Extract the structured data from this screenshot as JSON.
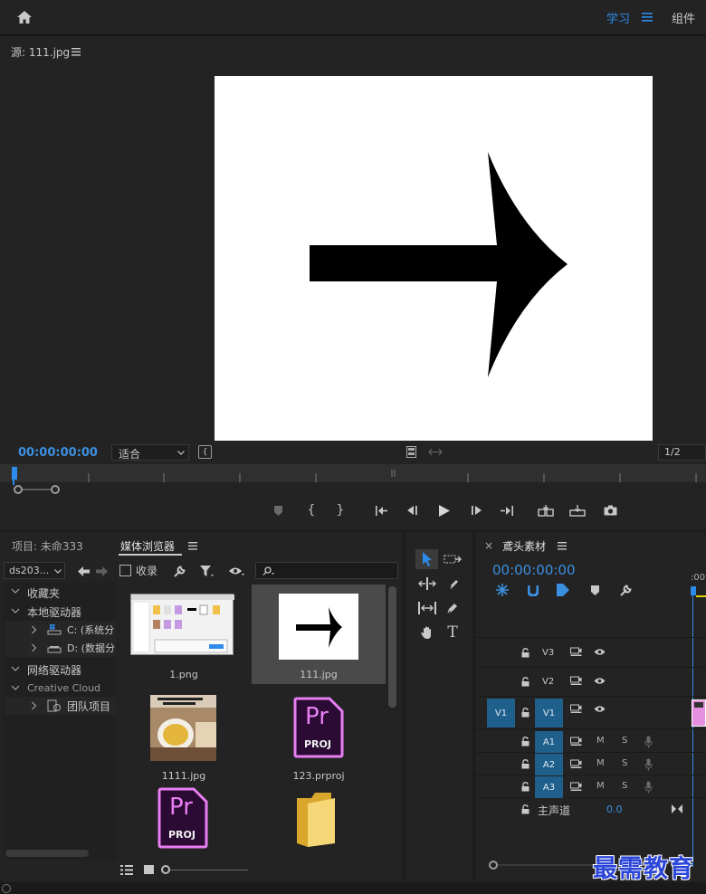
{
  "topbar": {
    "learn_label": "学习",
    "components_label": "组件"
  },
  "source": {
    "title": "源: 111.jpg",
    "timecode": "00:00:00:00",
    "fit_value": "适合",
    "resolution_value": "1/2"
  },
  "project": {
    "tab_project": "项目: 未命333",
    "tab_media_browser": "媒体浏览器",
    "drive_select": "ds203...",
    "ingest_label": "收录",
    "tree": {
      "favorites": "收藏夹",
      "local_drives": "本地驱动器",
      "drive_c": "C: (系统分",
      "drive_d": "D: (数据分",
      "network_drives": "网络驱动器",
      "creative_cloud": "Creative Cloud",
      "team_projects": "团队项目"
    },
    "files": [
      {
        "name": "1.png"
      },
      {
        "name": "111.jpg"
      },
      {
        "name": "1111.jpg"
      },
      {
        "name": "123.prproj"
      },
      {
        "name": ""
      },
      {
        "name": ""
      }
    ],
    "proj_icon_text": "Pr",
    "proj_icon_sub": "PROJ"
  },
  "timeline": {
    "title": "鳶头素材",
    "timecode": "00:00:00:00",
    "ruler_label": ":00",
    "tracks": {
      "v3": "V3",
      "v2": "V2",
      "v1": "V1",
      "v1_src": "V1",
      "a1": "A1",
      "a2": "A2",
      "a3": "A3",
      "m": "M",
      "s": "S",
      "master": "主声道",
      "master_value": "0.0"
    }
  },
  "watermark": "最需教育",
  "colors": {
    "accent": "#2d8ceb",
    "timecode_blue": "#3b8fe0",
    "track_blue": "#1f5f8b",
    "proj_pink": "#e77ef2"
  }
}
